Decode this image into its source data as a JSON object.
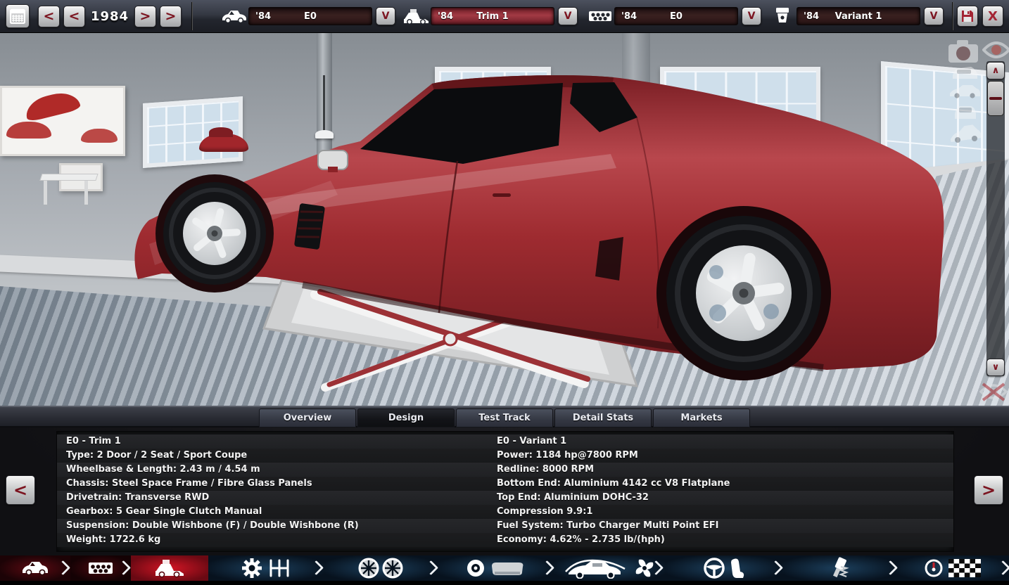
{
  "toolbar": {
    "year": "1984",
    "nav": {
      "prev_fast": "<",
      "prev": "<",
      "next": ">",
      "next_fast": ">"
    },
    "dropdown_arrow": "V",
    "close_label": "X",
    "dropdowns": [
      {
        "icon": "car-model-icon",
        "year": "'84",
        "value": "E0"
      },
      {
        "icon": "car-trim-icon",
        "year": "'84",
        "value": "Trim 1"
      },
      {
        "icon": "engine-family-icon",
        "year": "'84",
        "value": "E0"
      },
      {
        "icon": "engine-variant-icon",
        "year": "'84",
        "value": "Variant 1"
      }
    ]
  },
  "viewport": {
    "scroll_up": "∧",
    "scroll_down": "∨",
    "overlay_icons": [
      "screenshot-camera-icon",
      "visibility-eye-icon",
      "car-rear-view-icon",
      "car-side-view-icon",
      "car-front-view-icon",
      "car-three-quarter-view-icon",
      "hide-ui-eye-icon"
    ]
  },
  "tabs": {
    "items": [
      "Overview",
      "Design",
      "Test Track",
      "Detail Stats",
      "Markets"
    ],
    "active": "Design"
  },
  "panel": {
    "prev_label": "<",
    "next_label": ">",
    "stats_left": [
      "E0 - Trim 1",
      "Type: 2 Door / 2 Seat / Sport Coupe",
      "Wheelbase & Length: 2.43 m / 4.54 m",
      "Chassis: Steel Space Frame / Fibre Glass Panels",
      "Drivetrain: Transverse RWD",
      "Gearbox: 5 Gear Single Clutch Manual",
      "Suspension: Double Wishbone (F) / Double Wishbone (R)",
      "Weight: 1722.6 kg"
    ],
    "stats_right": [
      "E0 - Variant 1",
      "Power: 1184 hp@7800 RPM",
      "Redline: 8000 RPM",
      "Bottom End: Aluminium 4142 cc V8 Flatplane",
      "Top End: Aluminium DOHC-32",
      "Compression 9.9:1",
      "Fuel System: Turbo Charger Multi Point EFI",
      "Economy: 4.62% - 2.735 lb/(hph)"
    ]
  },
  "bottom_nav": {
    "items": [
      "car-model",
      "engine-family",
      "car-trim",
      "gearbox-drivetrain",
      "wheels-tires",
      "brakes",
      "body-aero-cooling",
      "interior-steering",
      "suspension",
      "test-finish"
    ]
  },
  "colors": {
    "car_red": "#9e2b30",
    "accent_dark_red": "#7c1420",
    "active_nav_red": "#d21524",
    "nav_blue": "#1c3f5c",
    "trim_field_red": "#a23a44",
    "metal_button": "#cbcccd"
  }
}
